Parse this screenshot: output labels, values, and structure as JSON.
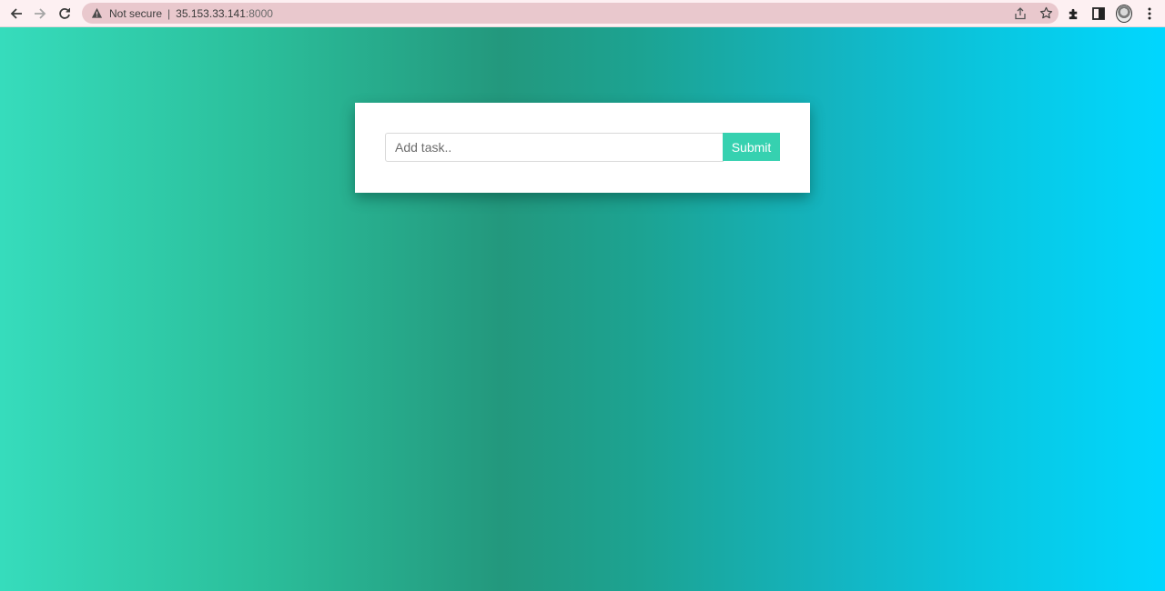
{
  "browser": {
    "security_label": "Not secure",
    "separator": "|",
    "url_host": "35.153.33.141",
    "url_port": ":8000",
    "nav_icons": [
      "back-arrow-icon",
      "forward-arrow-icon",
      "reload-icon"
    ],
    "omnibox_icons": [
      "share-icon",
      "star-bookmark-icon"
    ],
    "toolbar_icons": [
      "extensions-puzzle-icon",
      "side-panel-icon",
      "profile-avatar",
      "kebab-menu-icon"
    ]
  },
  "task_form": {
    "input_placeholder": "Add task..",
    "input_value": "",
    "submit_label": "Submit"
  },
  "colors": {
    "gradient_left": "#36dcbc",
    "gradient_mid": "#23987d",
    "gradient_right": "#00d7ff",
    "button_bg": "#36d1b0",
    "toolbar_bg": "#fdf0f2",
    "omnibox_bg": "#e9c8cd"
  }
}
